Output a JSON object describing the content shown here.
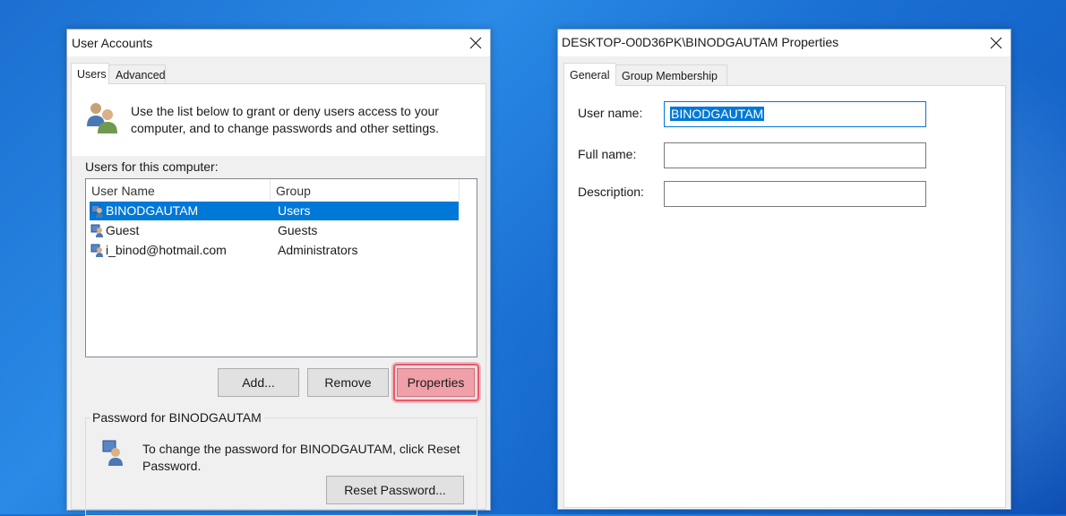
{
  "user_accounts": {
    "title": "User Accounts",
    "close_icon": "close-icon",
    "tabs": [
      {
        "label": "Users",
        "active": true
      },
      {
        "label": "Advanced",
        "active": false
      }
    ],
    "intro_text_line1": "Use the list below to grant or deny users access to your",
    "intro_text_line2": "computer, and to change passwords and other settings.",
    "users_label": "Users for this computer:",
    "columns": [
      "User Name",
      "Group"
    ],
    "rows": [
      {
        "name": "BINODGAUTAM",
        "group": "Users",
        "selected": true
      },
      {
        "name": "Guest",
        "group": "Guests",
        "selected": false
      },
      {
        "name": "i_binod@hotmail.com",
        "group": "Administrators",
        "selected": false
      }
    ],
    "buttons": {
      "add": "Add...",
      "remove": "Remove",
      "properties": "Properties"
    },
    "password_group_title": "Password for BINODGAUTAM",
    "password_text_line1": "To change the password for BINODGAUTAM, click Reset",
    "password_text_line2": "Password.",
    "reset_password": "Reset Password...",
    "highlight_color": "#e85a6a"
  },
  "properties_dialog": {
    "title": "DESKTOP-O0D36PK\\BINODGAUTAM Properties",
    "close_icon": "close-icon",
    "tabs": [
      {
        "label": "General",
        "active": true
      },
      {
        "label": "Group Membership",
        "active": false
      }
    ],
    "fields": {
      "user_name_label": "User name:",
      "user_name_value": "BINODGAUTAM",
      "full_name_label": "Full name:",
      "full_name_value": "",
      "description_label": "Description:",
      "description_value": ""
    }
  },
  "colors": {
    "selection": "#0078d7",
    "desktop": "#1a6fd2"
  }
}
